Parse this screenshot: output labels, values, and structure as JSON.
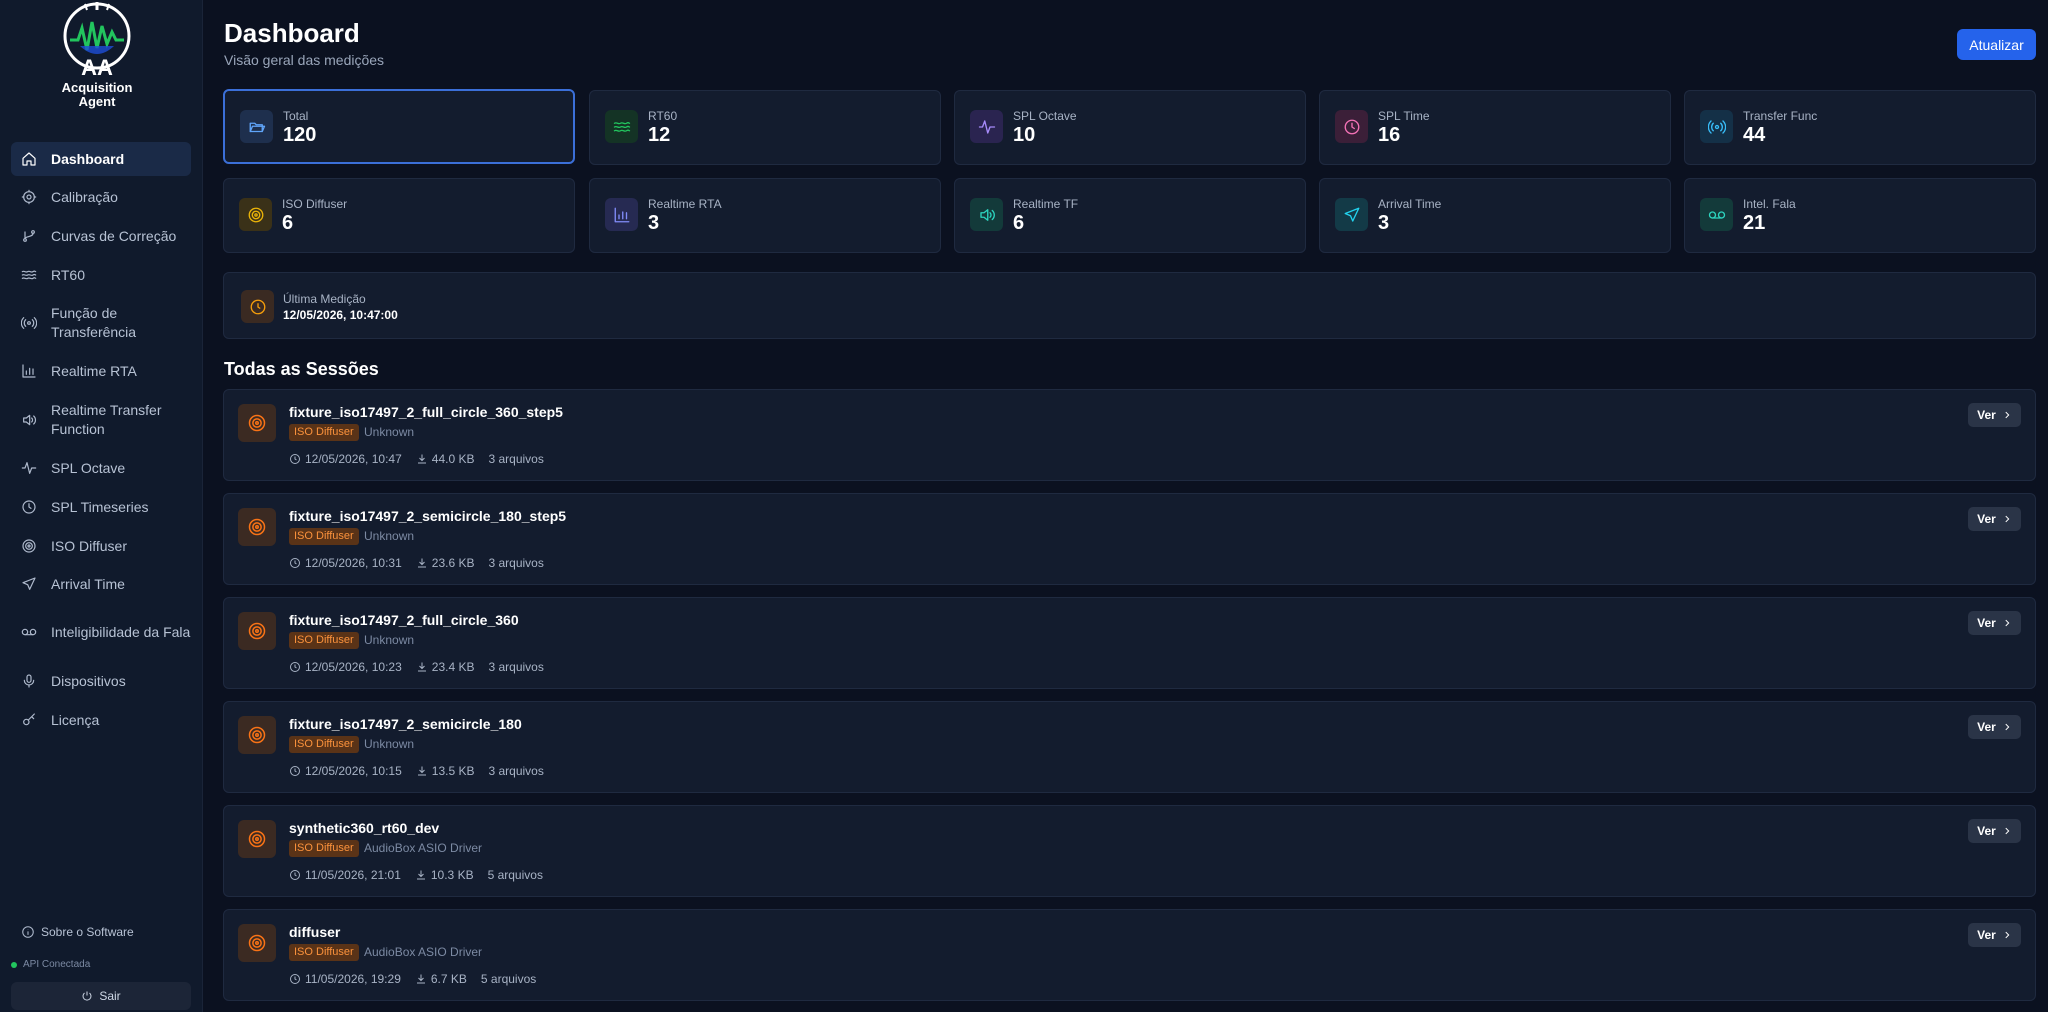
{
  "brand": {
    "line1": "AA",
    "line2": "Acquisition",
    "line3": "Agent"
  },
  "sidebar": {
    "items": [
      {
        "label": "Dashboard",
        "icon": "home-icon"
      },
      {
        "label": "Calibração",
        "icon": "gear-icon"
      },
      {
        "label": "Curvas de Correção",
        "icon": "git-branch-icon"
      },
      {
        "label": "RT60",
        "icon": "waves-icon"
      },
      {
        "label": "Função de Transferência",
        "icon": "radio-icon"
      },
      {
        "label": "Realtime RTA",
        "icon": "bar-chart-icon"
      },
      {
        "label": "Realtime Transfer Function",
        "icon": "speaker-icon"
      },
      {
        "label": "SPL Octave",
        "icon": "activity-icon"
      },
      {
        "label": "SPL Timeseries",
        "icon": "clock-icon"
      },
      {
        "label": "ISO Diffuser",
        "icon": "target-icon"
      },
      {
        "label": "Arrival Time",
        "icon": "send-icon"
      },
      {
        "label": "Inteligibilidade da Fala",
        "icon": "voicemail-icon"
      },
      {
        "label": "Dispositivos",
        "icon": "microphone-icon"
      },
      {
        "label": "Licença",
        "icon": "key-icon"
      }
    ],
    "about": "Sobre o Software",
    "api_status": "API Conectada",
    "logout": "Sair"
  },
  "header": {
    "title": "Dashboard",
    "subtitle": "Visão geral das medições",
    "refresh_label": "Atualizar"
  },
  "stats": [
    {
      "label": "Total",
      "value": "120",
      "icon": "folder-open-icon",
      "color": "#60a5fa",
      "bg": "#1e2f4d"
    },
    {
      "label": "RT60",
      "value": "12",
      "icon": "waves-icon",
      "color": "#22c55e",
      "bg": "#143325"
    },
    {
      "label": "SPL Octave",
      "value": "10",
      "icon": "activity-icon",
      "color": "#a78bfa",
      "bg": "#2a2450"
    },
    {
      "label": "SPL Time",
      "value": "16",
      "icon": "clock-icon",
      "color": "#f472b6",
      "bg": "#3b1f38"
    },
    {
      "label": "Transfer Func",
      "value": "44",
      "icon": "radio-icon",
      "color": "#38bdf8",
      "bg": "#143047"
    },
    {
      "label": "ISO Diffuser",
      "value": "6",
      "icon": "target-icon",
      "color": "#eab308",
      "bg": "#3a3118"
    },
    {
      "label": "Realtime RTA",
      "value": "3",
      "icon": "bar-chart-icon",
      "color": "#818cf8",
      "bg": "#262a52"
    },
    {
      "label": "Realtime TF",
      "value": "6",
      "icon": "speaker-icon",
      "color": "#2dd4bf",
      "bg": "#133a3a"
    },
    {
      "label": "Arrival Time",
      "value": "3",
      "icon": "send-icon",
      "color": "#22d3ee",
      "bg": "#133a47"
    },
    {
      "label": "Intel. Fala",
      "value": "21",
      "icon": "voicemail-icon",
      "color": "#2dd4bf",
      "bg": "#133a3a"
    }
  ],
  "last_measurement": {
    "label": "Última Medição",
    "value": "12/05/2026, 10:47:00"
  },
  "sessions_title": "Todas as Sessões",
  "sessions": [
    {
      "name": "fixture_iso17497_2_full_circle_360_step5",
      "type": "ISO Diffuser",
      "device": "Unknown",
      "date": "12/05/2026, 10:47",
      "size": "44.0 KB",
      "files": "3 arquivos",
      "action": "Ver"
    },
    {
      "name": "fixture_iso17497_2_semicircle_180_step5",
      "type": "ISO Diffuser",
      "device": "Unknown",
      "date": "12/05/2026, 10:31",
      "size": "23.6 KB",
      "files": "3 arquivos",
      "action": "Ver"
    },
    {
      "name": "fixture_iso17497_2_full_circle_360",
      "type": "ISO Diffuser",
      "device": "Unknown",
      "date": "12/05/2026, 10:23",
      "size": "23.4 KB",
      "files": "3 arquivos",
      "action": "Ver"
    },
    {
      "name": "fixture_iso17497_2_semicircle_180",
      "type": "ISO Diffuser",
      "device": "Unknown",
      "date": "12/05/2026, 10:15",
      "size": "13.5 KB",
      "files": "3 arquivos",
      "action": "Ver"
    },
    {
      "name": "synthetic360_rt60_dev",
      "type": "ISO Diffuser",
      "device": "AudioBox ASIO Driver",
      "date": "11/05/2026, 21:01",
      "size": "10.3 KB",
      "files": "5 arquivos",
      "action": "Ver"
    },
    {
      "name": "diffuser",
      "type": "ISO Diffuser",
      "device": "AudioBox ASIO Driver",
      "date": "11/05/2026, 19:29",
      "size": "6.7 KB",
      "files": "5 arquivos",
      "action": "Ver"
    }
  ]
}
